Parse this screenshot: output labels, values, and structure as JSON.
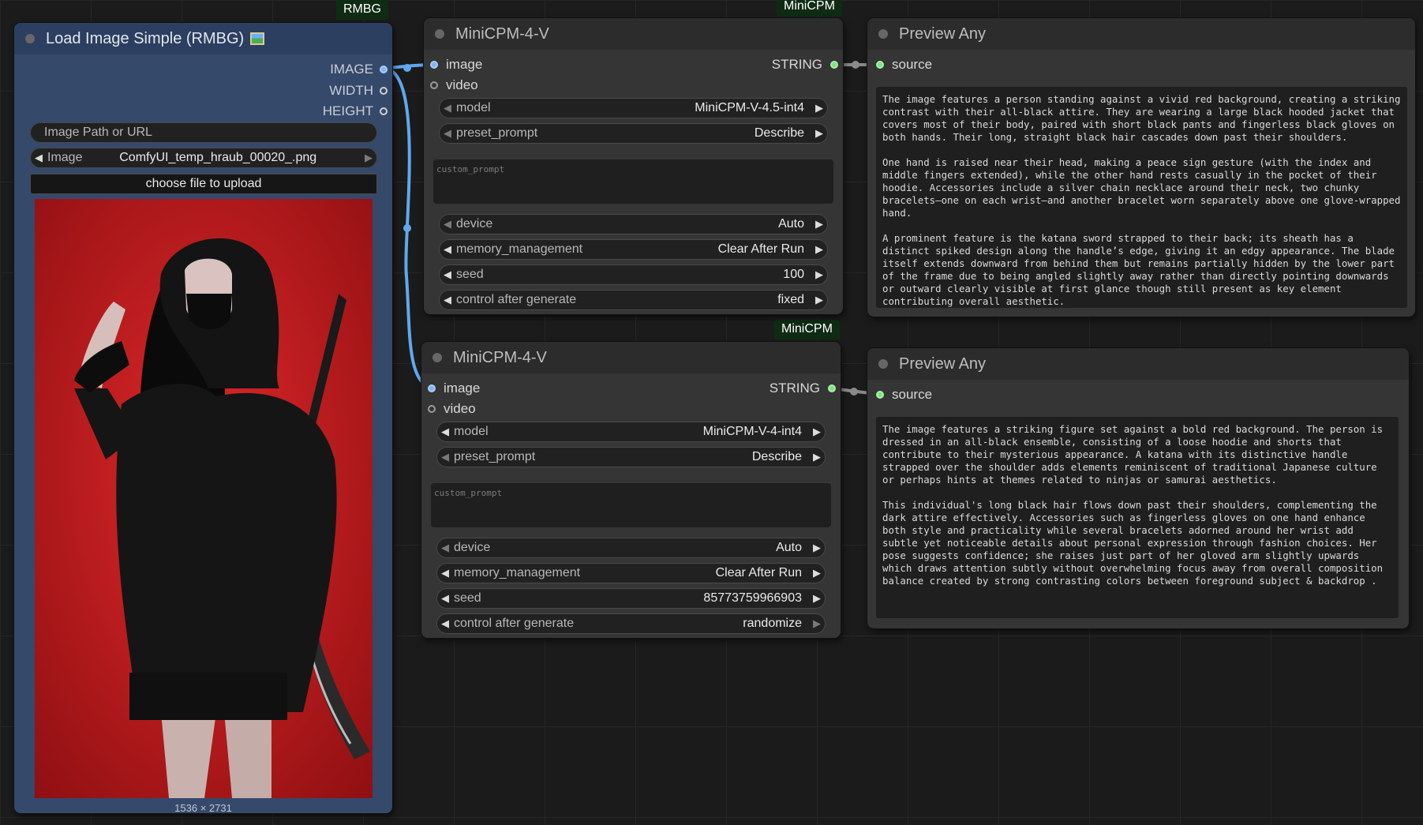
{
  "badges": {
    "rmbg": "RMBG",
    "minicpm_top": "MiniCPM",
    "minicpm_bottom": "MiniCPM"
  },
  "load_image": {
    "title": "Load Image Simple (RMBG)",
    "title_icon": "image-emoji-icon",
    "outputs": [
      "IMAGE",
      "WIDTH",
      "HEIGHT"
    ],
    "path_placeholder": "Image Path or URL",
    "image_label": "Image",
    "image_value": "ComfyUI_temp_hraub_00020_.png",
    "upload_label": "choose file to upload",
    "dimensions": "1536 × 2731"
  },
  "minicpm_1": {
    "title": "MiniCPM-4-V",
    "inputs": [
      "image",
      "video"
    ],
    "output": "STRING",
    "model_label": "model",
    "model_value": "MiniCPM-V-4.5-int4",
    "preset_label": "preset_prompt",
    "preset_value": "Describe",
    "custom_prompt_placeholder": "custom_prompt",
    "device_label": "device",
    "device_value": "Auto",
    "memory_label": "memory_management",
    "memory_value": "Clear After Run",
    "seed_label": "seed",
    "seed_value": "100",
    "control_label": "control after generate",
    "control_value": "fixed"
  },
  "minicpm_2": {
    "title": "MiniCPM-4-V",
    "inputs": [
      "image",
      "video"
    ],
    "output": "STRING",
    "model_label": "model",
    "model_value": "MiniCPM-V-4-int4",
    "preset_label": "preset_prompt",
    "preset_value": "Describe",
    "custom_prompt_placeholder": "custom_prompt",
    "device_label": "device",
    "device_value": "Auto",
    "memory_label": "memory_management",
    "memory_value": "Clear After Run",
    "seed_label": "seed",
    "seed_value": "85773759966903",
    "control_label": "control after generate",
    "control_value": "randomize"
  },
  "preview_1": {
    "title": "Preview Any",
    "input": "source",
    "text": "The image features a person standing against a vivid red background, creating a striking contrast with their all-black attire. They are wearing a large black hooded jacket that covers most of their body, paired with short black pants and fingerless black gloves on both hands. Their long, straight black hair cascades down past their shoulders.\n\nOne hand is raised near their head, making a peace sign gesture (with the index and middle fingers extended), while the other hand rests casually in the pocket of their hoodie. Accessories include a silver chain necklace around their neck, two chunky bracelets—one on each wrist—and another bracelet worn separately above one glove-wrapped hand.\n\nA prominent feature is the katana sword strapped to their back; its sheath has a distinct spiked design along the handle’s edge, giving it an edgy appearance. The blade itself extends downward from behind them but remains partially hidden by the lower part of the frame due to being angled slightly away rather than directly pointing downwards or outward clearly visible at first glance though still present as key element contributing overall aesthetic."
  },
  "preview_2": {
    "title": "Preview Any",
    "input": "source",
    "text": "The image features a striking figure set against a bold red background. The person is dressed in an all-black ensemble, consisting of a loose hoodie and shorts that contribute to their mysterious appearance. A katana with its distinctive handle strapped over the shoulder adds elements reminiscent of traditional Japanese culture or perhaps hints at themes related to ninjas or samurai aesthetics.\n\nThis individual's long black hair flows down past their shoulders, complementing the dark attire effectively. Accessories such as fingerless gloves on one hand enhance both style and practicality while several bracelets adorned around her wrist add subtle yet noticeable details about personal expression through fashion choices. Her pose suggests confidence; she raises just part of her gloved arm slightly upwards which draws attention subtly without overwhelming focus away from overall composition balance created by strong contrasting colors between foreground subject & backdrop ."
  },
  "colors": {
    "image_wire": "#5fa8f0",
    "string_wire": "#8a8a8a",
    "string_slot": "#7ee37e",
    "group_blue": "#35496b"
  }
}
